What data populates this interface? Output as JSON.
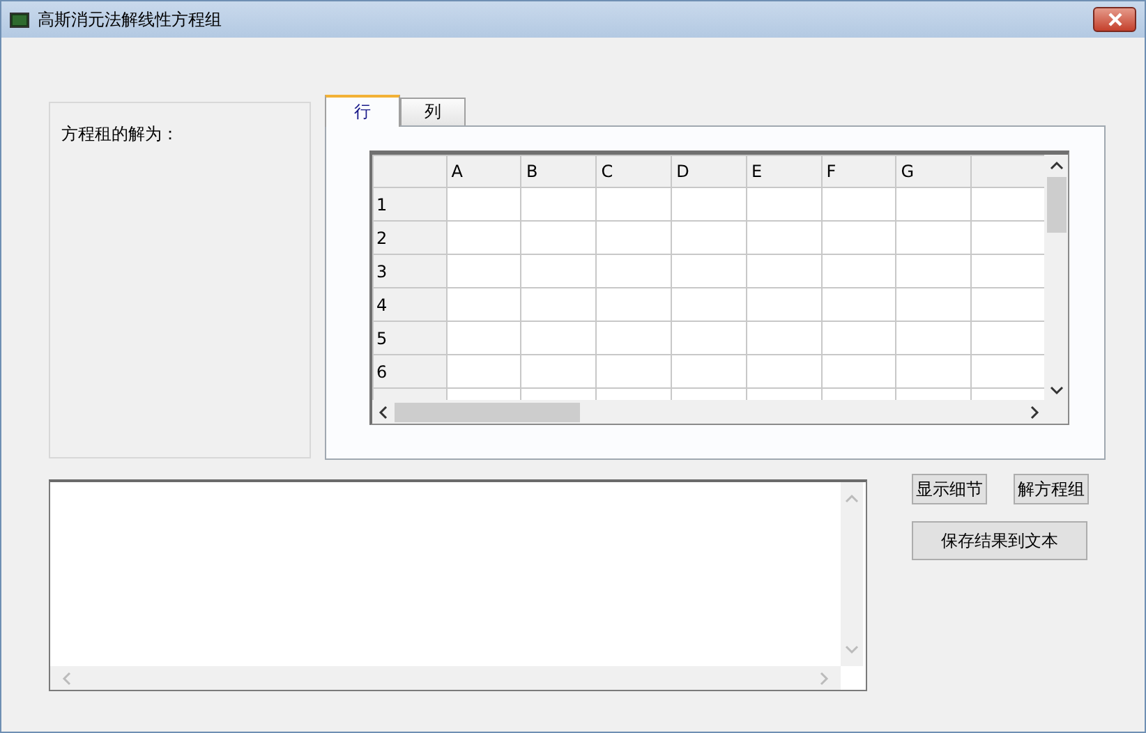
{
  "window": {
    "title": "高斯消元法解线性方程组"
  },
  "solution_panel": {
    "label": "方程租的解为："
  },
  "tabs": [
    {
      "label": "行",
      "selected": true
    },
    {
      "label": "列",
      "selected": false
    }
  ],
  "grid": {
    "columns": [
      "A",
      "B",
      "C",
      "D",
      "E",
      "F",
      "G"
    ],
    "rows": [
      "1",
      "2",
      "3",
      "4",
      "5",
      "6"
    ]
  },
  "buttons": [
    {
      "label": "显示细节"
    },
    {
      "label": "解方程组"
    },
    {
      "label": "保存结果到文本"
    }
  ]
}
